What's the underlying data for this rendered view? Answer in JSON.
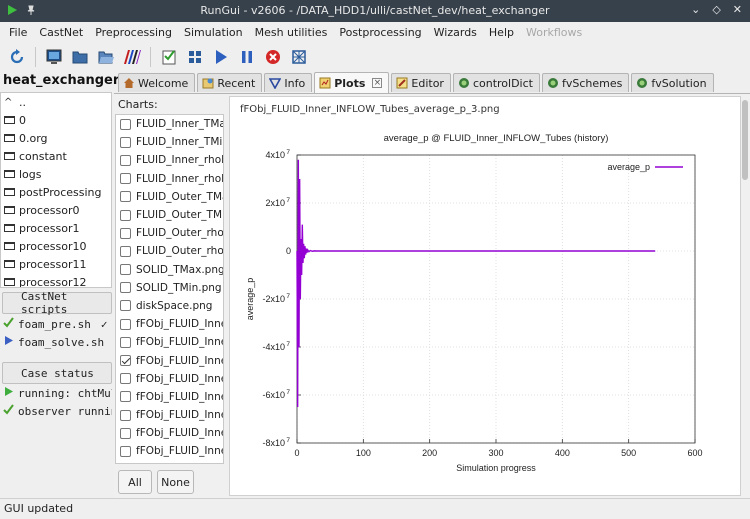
{
  "window": {
    "title": "RunGui - v2606 - /DATA_HDD1/ulli/castNet_dev/heat_exchanger"
  },
  "menu": [
    "File",
    "CastNet",
    "Preprocessing",
    "Simulation",
    "Mesh utilities",
    "Postprocessing",
    "Wizards",
    "Help",
    "Workflows"
  ],
  "toolbar": {
    "icons": [
      "refresh-icon",
      "monitor-icon",
      "folder-icon",
      "open-folder-icon",
      "colormap-icon",
      "checklist-icon",
      "grid-icon",
      "play-icon",
      "pause-icon",
      "stop-icon",
      "mesh-icon"
    ]
  },
  "case": {
    "name": "heat_exchanger",
    "tree": [
      "..",
      "0",
      "0.org",
      "constant",
      "logs",
      "postProcessing",
      "processor0",
      "processor1",
      "processor10",
      "processor11",
      "processor12"
    ]
  },
  "scripts": {
    "header": "CastNet scripts",
    "items": [
      {
        "label": "foam_pre.sh",
        "mark": "✓",
        "state": "done"
      },
      {
        "label": "foam_solve.sh",
        "mark": "",
        "state": "running"
      }
    ]
  },
  "case_status": {
    "header": "Case status",
    "items": [
      {
        "label": "running: chtMultiRegionFoam",
        "state": "running"
      },
      {
        "label": "observer running",
        "state": "done"
      }
    ]
  },
  "tabs": [
    {
      "label": "Welcome",
      "icon": "home-icon",
      "active": false
    },
    {
      "label": "Recent",
      "icon": "recent-icon",
      "active": false
    },
    {
      "label": "Info",
      "icon": "info-icon",
      "active": false
    },
    {
      "label": "Plots",
      "icon": "plots-icon",
      "active": true,
      "closable": true
    },
    {
      "label": "Editor",
      "icon": "editor-icon",
      "active": false
    },
    {
      "label": "controlDict",
      "icon": "dict-icon",
      "active": false
    },
    {
      "label": "fvSchemes",
      "icon": "dict-icon",
      "active": false
    },
    {
      "label": "fvSolution",
      "icon": "dict-icon",
      "active": false
    }
  ],
  "charts": {
    "label": "Charts:",
    "items": [
      {
        "label": "FLUID_Inner_TMax",
        "checked": false
      },
      {
        "label": "FLUID_Inner_TMin.",
        "checked": false
      },
      {
        "label": "FLUID_Inner_rhoM",
        "checked": false
      },
      {
        "label": "FLUID_Inner_rhoM",
        "checked": false
      },
      {
        "label": "FLUID_Outer_TMax",
        "checked": false
      },
      {
        "label": "FLUID_Outer_TMin.",
        "checked": false
      },
      {
        "label": "FLUID_Outer_rhoM",
        "checked": false
      },
      {
        "label": "FLUID_Outer_rhoM",
        "checked": false
      },
      {
        "label": "SOLID_TMax.png",
        "checked": false
      },
      {
        "label": "SOLID_TMin.png",
        "checked": false
      },
      {
        "label": "diskSpace.png",
        "checked": false
      },
      {
        "label": "fFObj_FLUID_Inner",
        "checked": false
      },
      {
        "label": "fFObj_FLUID_Inner",
        "checked": false
      },
      {
        "label": "fFObj_FLUID_Inner",
        "checked": true
      },
      {
        "label": "fFObj_FLUID_Inner",
        "checked": false
      },
      {
        "label": "fFObj_FLUID_Inner",
        "checked": false
      },
      {
        "label": "fFObj_FLUID_Inner",
        "checked": false
      },
      {
        "label": "fFObj_FLUID_Inner",
        "checked": false
      },
      {
        "label": "fFObj_FLUID_Inner",
        "checked": false
      }
    ],
    "all_label": "All",
    "none_label": "None"
  },
  "plot": {
    "filename": "fFObj_FLUID_Inner_INFLOW_Tubes_average_p_3.png"
  },
  "chart_data": {
    "type": "line",
    "title": "average_p @ FLUID_Inner_INFLOW_Tubes (history)",
    "xlabel": "Simulation progress",
    "ylabel": "average_p",
    "xlim": [
      0,
      600
    ],
    "ylim": [
      -80000000,
      40000000
    ],
    "xticks": [
      "0",
      "100",
      "200",
      "300",
      "400",
      "500",
      "600"
    ],
    "yticks": [
      "4x10",
      "2x10",
      "0",
      "-2x10",
      "-4x10",
      "-6x10",
      "-8x10"
    ],
    "ytick_values": [
      40000000,
      20000000,
      0,
      -20000000,
      -40000000,
      -60000000,
      -80000000
    ],
    "ytick_exp": "7",
    "legend": "top-right",
    "grid": true,
    "color": "#9400d3",
    "series": [
      {
        "name": "average_p",
        "x": [
          0,
          1,
          2,
          3,
          4,
          5,
          6,
          7,
          8,
          9,
          10,
          11,
          12,
          13,
          14,
          15,
          16,
          18,
          20,
          23,
          26,
          30,
          35,
          40,
          60,
          100,
          200,
          300,
          400,
          500,
          540
        ],
        "y": [
          0,
          -65000000,
          38000000,
          -40000000,
          30000000,
          -20000000,
          5000000,
          -10000000,
          11000000,
          -5000000,
          3000000,
          -3000000,
          2000000,
          -1500000,
          1000000,
          -700000,
          500000,
          -300000,
          200000,
          -100000,
          50000,
          0,
          0,
          0,
          0,
          0,
          0,
          0,
          0,
          0,
          0
        ]
      }
    ]
  },
  "status": "GUI updated"
}
